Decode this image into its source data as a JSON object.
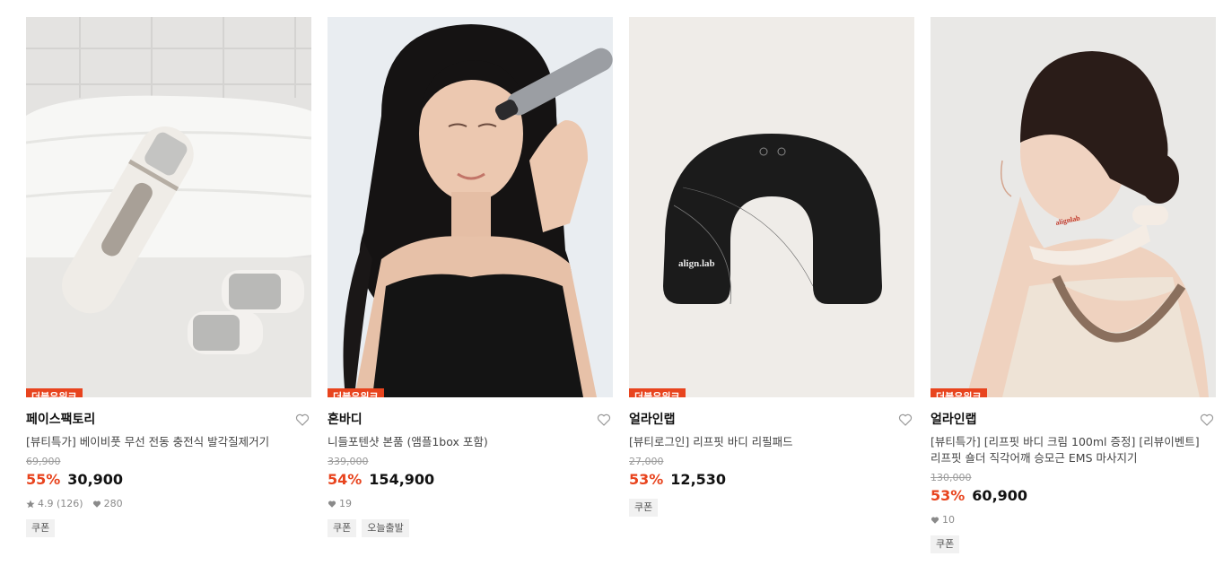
{
  "products": [
    {
      "badge": "더블유위크",
      "brand": "페이스팩토리",
      "title": "[뷰티특가] 베이비풋 무선 전동 충전식 발각질제거기",
      "original_price": "69,900",
      "discount": "55%",
      "price": "30,900",
      "rating": "4.9 (126)",
      "likes": "280",
      "tags": [
        "쿠폰"
      ],
      "image_alt": "white electric foot callus remover on a towel"
    },
    {
      "badge": "더블유위크",
      "brand": "혼바디",
      "title": "니들포텐샷 본품 (앰플1box 포함)",
      "original_price": "339,000",
      "discount": "54%",
      "price": "154,900",
      "rating": "",
      "likes": "19",
      "tags": [
        "쿠폰",
        "오늘출발"
      ],
      "image_alt": "woman using a facial device"
    },
    {
      "badge": "더블유위크",
      "brand": "얼라인랩",
      "title": "[뷰티로그인] 리프핏 바디 리필패드",
      "original_price": "27,000",
      "discount": "53%",
      "price": "12,530",
      "rating": "",
      "likes": "",
      "tags": [
        "쿠폰"
      ],
      "image_alt": "black U-shaped body pad",
      "pad_logo": "align.lab"
    },
    {
      "badge": "더블유위크",
      "brand": "얼라인랩",
      "title": "[뷰티특가] [리프핏 바디 크림 100ml 증정] [리뷰이벤트] 리프핏 숄더 직각어깨 승모근 EMS 마사지기",
      "original_price": "130,000",
      "discount": "53%",
      "price": "60,900",
      "rating": "",
      "likes": "10",
      "tags": [
        "쿠폰"
      ],
      "image_alt": "woman wearing a neck massager",
      "device_logo": "alignlab"
    }
  ],
  "colors": {
    "accent": "#e8441e",
    "tag_bg": "#f1f1f1"
  }
}
